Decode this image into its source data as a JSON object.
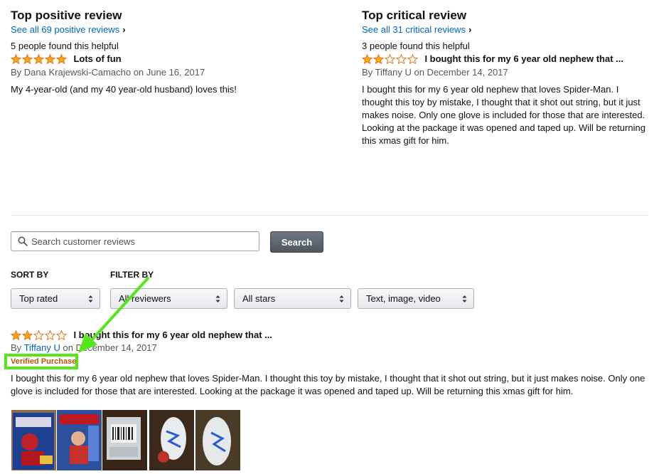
{
  "top_positive": {
    "heading": "Top positive review",
    "see_all": "See all 69 positive reviews",
    "helpful": "5 people found this helpful",
    "rating": 5,
    "title": "Lots of fun",
    "by": "By",
    "author": "Dana Krajewski-Camacho",
    "date": "on June 16, 2017",
    "body": "My 4-year-old (and my 40 year-old husband) loves this!"
  },
  "top_critical": {
    "heading": "Top critical review",
    "see_all": "See all 31 critical reviews",
    "helpful": "3 people found this helpful",
    "rating": 2,
    "title": "I bought this for my 6 year old nephew that ...",
    "by": "By",
    "author": "Tiffany U",
    "date": "on December 14, 2017",
    "body": "I bought this for my 6 year old nephew that loves Spider-Man. I thought this toy by mistake, I thought that it shot out string, but it just makes noise. Only one glove is included for those that are interested. Looking at the package it was opened and taped up. Will be returning this xmas gift for him."
  },
  "search": {
    "placeholder": "Search customer reviews",
    "button": "Search"
  },
  "sort": {
    "label": "SORT BY",
    "selected": "Top rated"
  },
  "filter": {
    "label": "FILTER BY",
    "reviewers": "All reviewers",
    "stars": "All stars",
    "media": "Text, image, video"
  },
  "review": {
    "rating": 2,
    "title": "I bought this for my 6 year old nephew that ...",
    "by": "By",
    "author": "Tiffany U",
    "date": "on December 14, 2017",
    "verified": "Verified Purchase",
    "body": "I bought this for my 6 year old nephew that loves Spider-Man. I thought this toy by mistake, I thought that it shot out string, but it just makes noise. Only one glove is included for those that are interested. Looking at the package it was opened and taped up. Will be returning this xmas gift for him."
  },
  "colors": {
    "star_fill": "#ffa41c",
    "star_outline": "#de7921",
    "link": "#0066c0",
    "verified": "#c45500",
    "annotation": "#57e61a"
  },
  "icons": {
    "search": "search-icon",
    "dropdown": "updown-arrow-icon",
    "chevron": "chevron-right-icon"
  }
}
